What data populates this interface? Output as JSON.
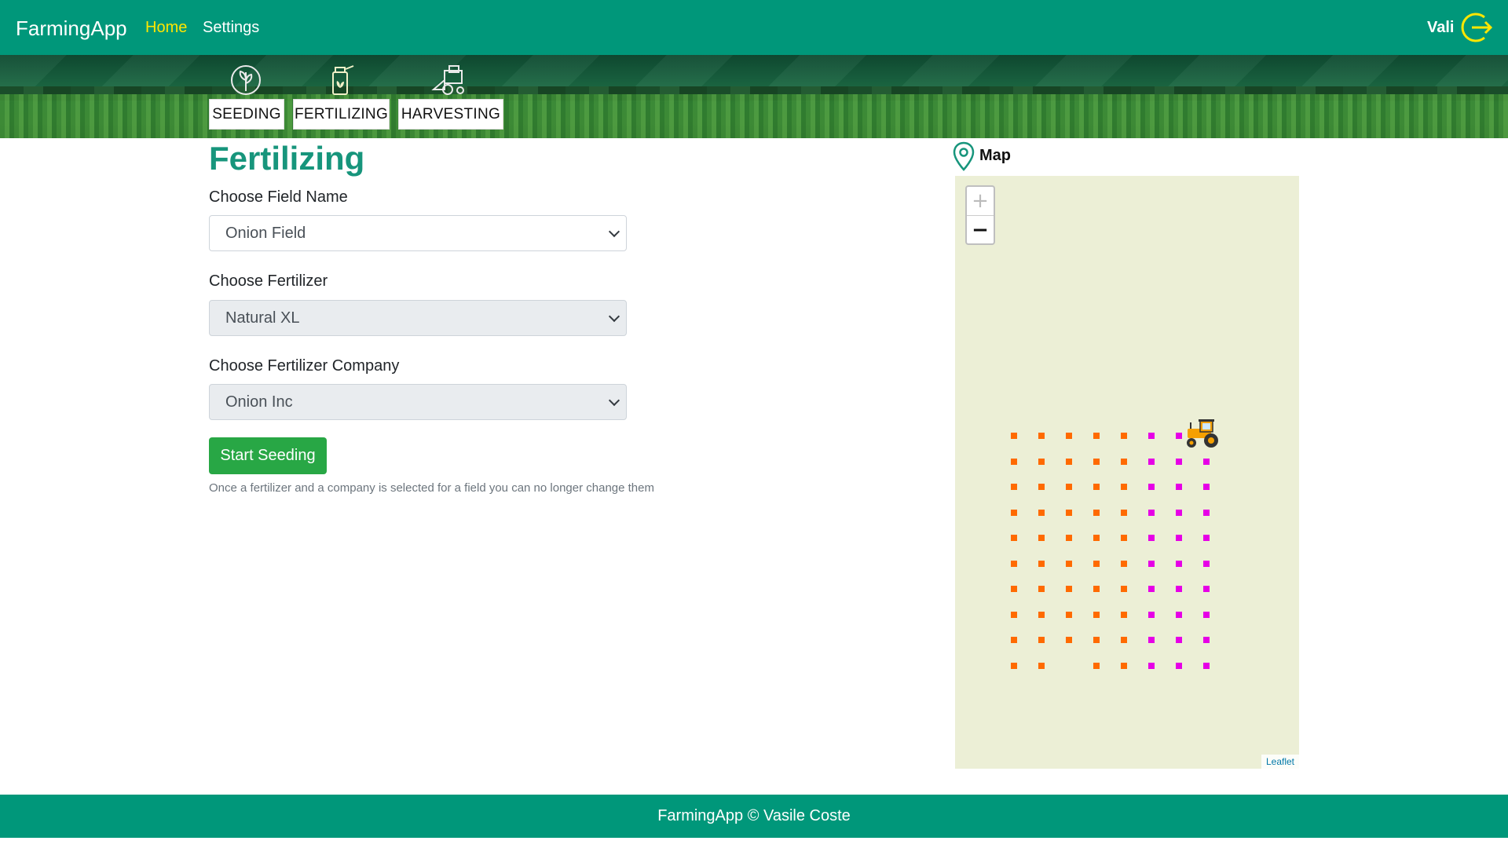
{
  "navbar": {
    "brand": "FarmingApp",
    "links": [
      {
        "label": "Home",
        "active": true
      },
      {
        "label": "Settings",
        "active": false
      }
    ],
    "user": "Vali",
    "logout_icon": "logout-arrow-icon"
  },
  "operations": [
    {
      "label": "SEEDING",
      "icon": "seedling-icon"
    },
    {
      "label": "FERTILIZING",
      "icon": "fertilizer-icon"
    },
    {
      "label": "HARVESTING",
      "icon": "harvester-icon"
    }
  ],
  "form": {
    "title": "Fertilizing",
    "field_label": "Choose Field Name",
    "field_value": "Onion Field",
    "fertilizer_label": "Choose Fertilizer",
    "fertilizer_value": "Natural XL",
    "company_label": "Choose Fertilizer Company",
    "company_value": "Onion Inc",
    "button_label": "Start Seeding",
    "help_text": "Once a fertilizer and a company is selected for a field you can no longer change them"
  },
  "map": {
    "title": "Map",
    "zoom_in": "+",
    "zoom_out": "−",
    "attribution": "Leaflet",
    "colors": {
      "fertilized": "#ff6a00",
      "pending": "#e600e6",
      "background": "#ecefd6"
    },
    "grid": {
      "rows": 10,
      "cols": 8,
      "row_colors": [
        [
          "orange",
          "orange",
          "orange",
          "orange",
          "orange",
          "magenta",
          "magenta",
          null
        ],
        [
          "orange",
          "orange",
          "orange",
          "orange",
          "orange",
          "magenta",
          "magenta",
          "magenta"
        ],
        [
          "orange",
          "orange",
          "orange",
          "orange",
          "orange",
          "magenta",
          "magenta",
          "magenta"
        ],
        [
          "orange",
          "orange",
          "orange",
          "orange",
          "orange",
          "magenta",
          "magenta",
          "magenta"
        ],
        [
          "orange",
          "orange",
          "orange",
          "orange",
          "orange",
          "magenta",
          "magenta",
          "magenta"
        ],
        [
          "orange",
          "orange",
          "orange",
          "orange",
          "orange",
          "magenta",
          "magenta",
          "magenta"
        ],
        [
          "orange",
          "orange",
          "orange",
          "orange",
          "orange",
          "magenta",
          "magenta",
          "magenta"
        ],
        [
          "orange",
          "orange",
          "orange",
          "orange",
          "orange",
          "magenta",
          "magenta",
          "magenta"
        ],
        [
          "orange",
          "orange",
          "orange",
          "orange",
          "orange",
          "magenta",
          "magenta",
          "magenta"
        ],
        [
          "orange",
          "orange",
          null,
          "orange",
          "orange",
          "magenta",
          "magenta",
          "magenta"
        ]
      ]
    },
    "tractor_icon": "tractor-icon"
  },
  "footer": {
    "text": "FarmingApp © Vasile Coste"
  }
}
